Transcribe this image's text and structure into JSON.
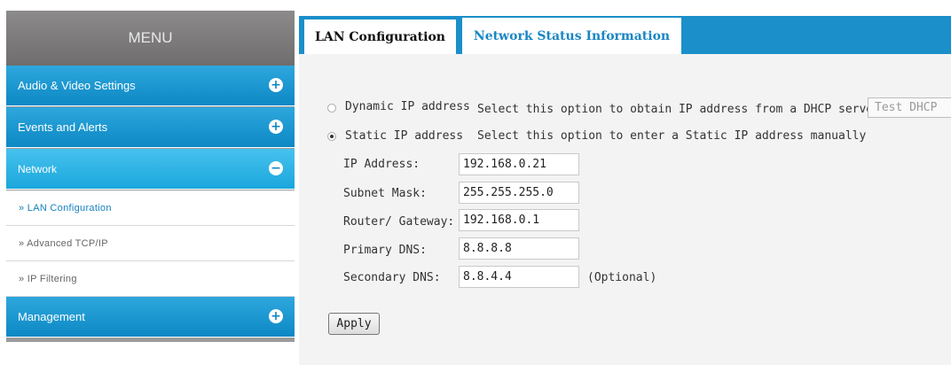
{
  "sidebar": {
    "header": "MENU",
    "categories": [
      {
        "label": "Audio & Video Settings",
        "icon": "plus-circle-icon"
      },
      {
        "label": "Events and Alerts",
        "icon": "plus-circle-icon"
      },
      {
        "label": "Network",
        "icon": "minus-circle-icon"
      },
      {
        "label": "Management",
        "icon": "plus-circle-icon"
      }
    ],
    "network_items": [
      {
        "label": "» LAN Configuration"
      },
      {
        "label": "» Advanced TCP/IP"
      },
      {
        "label": "» IP Filtering"
      }
    ],
    "icon_glyphs": {
      "plus": "+",
      "minus": "−"
    }
  },
  "tabs": [
    {
      "label": "LAN Configuration"
    },
    {
      "label": "Network Status Information"
    }
  ],
  "form": {
    "dynamic": {
      "label": "Dynamic IP address",
      "description": "Select this option to obtain IP address from a DHCP server",
      "button": "Test DHCP",
      "selected": false
    },
    "static": {
      "label": "Static IP address",
      "description": "Select this option to enter a Static IP address manually",
      "selected": true
    },
    "fields": [
      {
        "label": "IP Address:",
        "value": "192.168.0.21"
      },
      {
        "label": "Subnet Mask:",
        "value": "255.255.255.0"
      },
      {
        "label": "Router/ Gateway:",
        "value": "192.168.0.1"
      },
      {
        "label": "Primary DNS:",
        "value": "8.8.8.8"
      },
      {
        "label": "Secondary DNS:",
        "value": "8.8.4.4",
        "note": "(Optional)"
      }
    ],
    "apply_label": "Apply"
  },
  "colors": {
    "accent": "#1a8fca",
    "menu_header": "#7c7a7a",
    "panel_bg": "#f3f3f3"
  }
}
